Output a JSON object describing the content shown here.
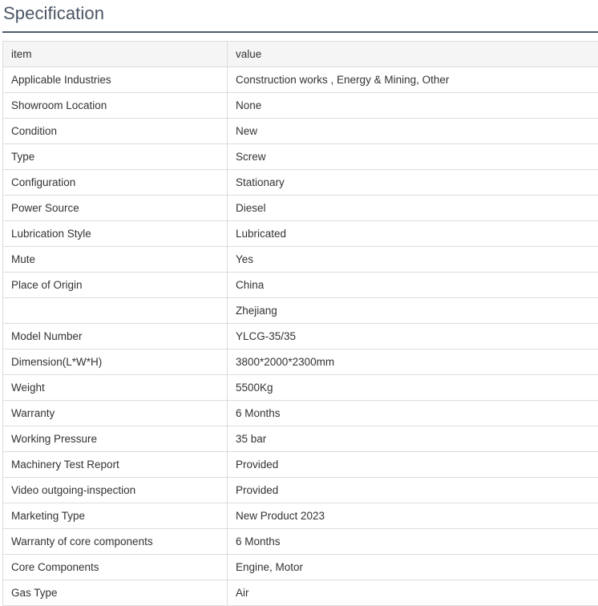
{
  "section": {
    "title": "Specification"
  },
  "table": {
    "header": {
      "item": "item",
      "value": "value"
    },
    "rows": [
      {
        "item": "Applicable Industries",
        "value": "Construction works , Energy & Mining, Other"
      },
      {
        "item": "Showroom Location",
        "value": "None"
      },
      {
        "item": "Condition",
        "value": "New"
      },
      {
        "item": "Type",
        "value": "Screw"
      },
      {
        "item": "Configuration",
        "value": "Stationary"
      },
      {
        "item": "Power Source",
        "value": "Diesel"
      },
      {
        "item": "Lubrication Style",
        "value": "Lubricated"
      },
      {
        "item": "Mute",
        "value": "Yes"
      },
      {
        "item": "Place of Origin",
        "value": "China"
      },
      {
        "item": "",
        "value": "Zhejiang"
      },
      {
        "item": "Model Number",
        "value": "YLCG-35/35"
      },
      {
        "item": "Dimension(L*W*H)",
        "value": "3800*2000*2300mm"
      },
      {
        "item": "Weight",
        "value": "5500Kg"
      },
      {
        "item": "Warranty",
        "value": "6 Months"
      },
      {
        "item": "Working Pressure",
        "value": "35 bar"
      },
      {
        "item": "Machinery Test Report",
        "value": "Provided"
      },
      {
        "item": "Video outgoing-inspection",
        "value": "Provided"
      },
      {
        "item": "Marketing Type",
        "value": "New Product 2023"
      },
      {
        "item": "Warranty of core components",
        "value": "6 Months"
      },
      {
        "item": "Core Components",
        "value": "Engine, Motor"
      },
      {
        "item": "Gas Type",
        "value": "Air"
      }
    ]
  },
  "colors": {
    "title_text": "#4a5566",
    "title_rule": "#4f5b6e",
    "border": "#dcdcdc",
    "header_bg": "#f5f5f5",
    "text": "#333333"
  }
}
